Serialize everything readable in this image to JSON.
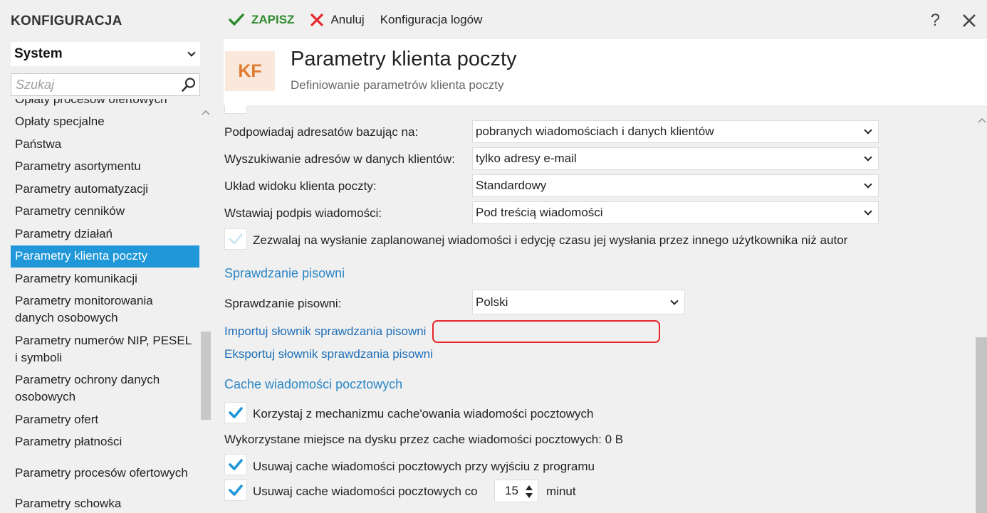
{
  "app": {
    "title": "KONFIGURACJA"
  },
  "sidebar": {
    "system_select": "System",
    "search_placeholder": "Szukaj",
    "items": [
      {
        "label": "Opłaty procesów ofertowych",
        "active": false
      },
      {
        "label": "Opłaty specjalne",
        "active": false
      },
      {
        "label": "Państwa",
        "active": false
      },
      {
        "label": "Parametry asortymentu",
        "active": false
      },
      {
        "label": "Parametry automatyzacji",
        "active": false
      },
      {
        "label": "Parametry cenników",
        "active": false
      },
      {
        "label": "Parametry działań",
        "active": false
      },
      {
        "label": "Parametry klienta poczty",
        "active": true
      },
      {
        "label": "Parametry komunikacji",
        "active": false
      },
      {
        "label": "Parametry monitorowania danych osobowych",
        "active": false
      },
      {
        "label": "Parametry numerów NIP, PESEL i symboli",
        "active": false
      },
      {
        "label": "Parametry ochrony danych osobowych",
        "active": false
      },
      {
        "label": "Parametry ofert",
        "active": false
      },
      {
        "label": "Parametry płatności",
        "active": false
      },
      {
        "label": "Parametry procesów ofertowych",
        "active": false
      },
      {
        "label": "Parametry schowka",
        "active": false
      }
    ]
  },
  "toolbar": {
    "save_label": "ZAPISZ",
    "cancel_label": "Anuluj",
    "logs_label": "Konfiguracja logów",
    "help_label": "?"
  },
  "header": {
    "badge": "KF",
    "title": "Parametry klienta poczty",
    "subtitle": "Definiowanie parametrów klienta poczty"
  },
  "settings": {
    "suggest_label": "Podpowiadaj adresatów bazując na:",
    "suggest_value": "pobranych wiadomościach i danych klientów",
    "search_label": "Wyszukiwanie adresów w danych klientów:",
    "search_value": "tylko adresy e-mail",
    "layout_label": "Układ widoku klienta poczty:",
    "layout_value": "Standardowy",
    "signature_label": "Wstawiaj podpis wiadomości:",
    "signature_value": "Pod treścią wiadomości",
    "allow_scheduled_label": "Zezwalaj na wysłanie zaplanowanej wiadomości i edycję czasu jej wysłania przez innego użytkownika niż autor",
    "allow_scheduled_checked": false
  },
  "spelling": {
    "section_title": "Sprawdzanie pisowni",
    "label": "Sprawdzanie pisowni:",
    "value": "Polski",
    "import_link": "Importuj słownik sprawdzania pisowni",
    "export_link": "Eksportuj słownik sprawdzania pisowni"
  },
  "cache": {
    "section_title": "Cache wiadomości pocztowych",
    "use_cache_label": "Korzystaj z mechanizmu cache'owania wiadomości pocztowych",
    "use_cache_checked": true,
    "disk_usage_text": "Wykorzystane miejsce na dysku przez cache wiadomości pocztowych: 0 B",
    "clear_on_exit_label": "Usuwaj cache wiadomości pocztowych przy wyjściu z programu",
    "clear_on_exit_checked": true,
    "clear_every_label": "Usuwaj cache wiadomości pocztowych co",
    "clear_every_checked": true,
    "clear_every_value": "15",
    "clear_every_unit": "minut"
  },
  "colors": {
    "accent": "#1f97d8",
    "save_green": "#2e8b2e",
    "cancel_red": "#e5262b",
    "link_blue": "#1e6fb8",
    "badge_bg": "#fbe8dc",
    "badge_fg": "#e07a2e"
  },
  "icons": {
    "save": "checkmark-icon",
    "cancel": "x-icon",
    "search": "magnifier-icon",
    "close": "close-icon",
    "help": "question-icon"
  }
}
